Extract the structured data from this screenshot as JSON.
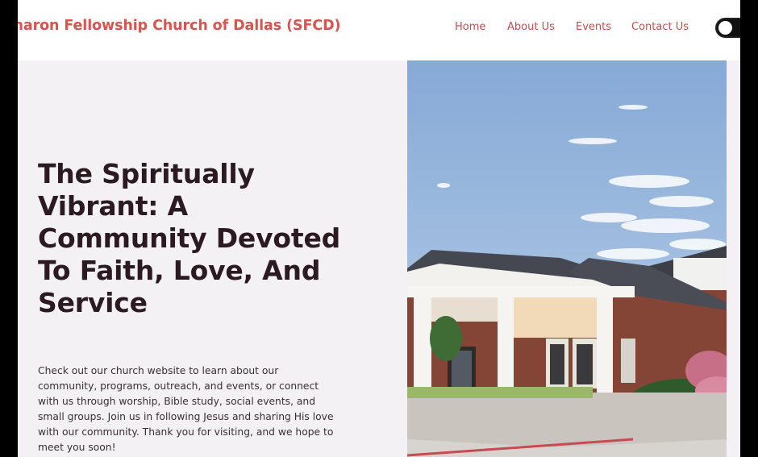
{
  "header": {
    "brand": "Sharon Fellowship Church of Dallas (SFCD)",
    "nav": [
      {
        "label": "Home"
      },
      {
        "label": "About Us"
      },
      {
        "label": "Events"
      },
      {
        "label": "Contact Us"
      }
    ],
    "theme_toggle_icon": "toggle-switch-icon"
  },
  "hero": {
    "title": "The Spiritually Vibrant: A Community Devoted To Faith, Love, And Service",
    "text": "Check out our church website to learn about our community, programs, outreach, and events, or connect with us through worship, Bible study, social events, and small groups. Join us in following Jesus and sharing His love with our community. Thank you for visiting, and we hope to meet you soon!"
  },
  "colors": {
    "brand": "#d9534f",
    "nav": "#c0504d",
    "heading": "#2b1a1f",
    "hero_bg": "#f3f1f4"
  }
}
